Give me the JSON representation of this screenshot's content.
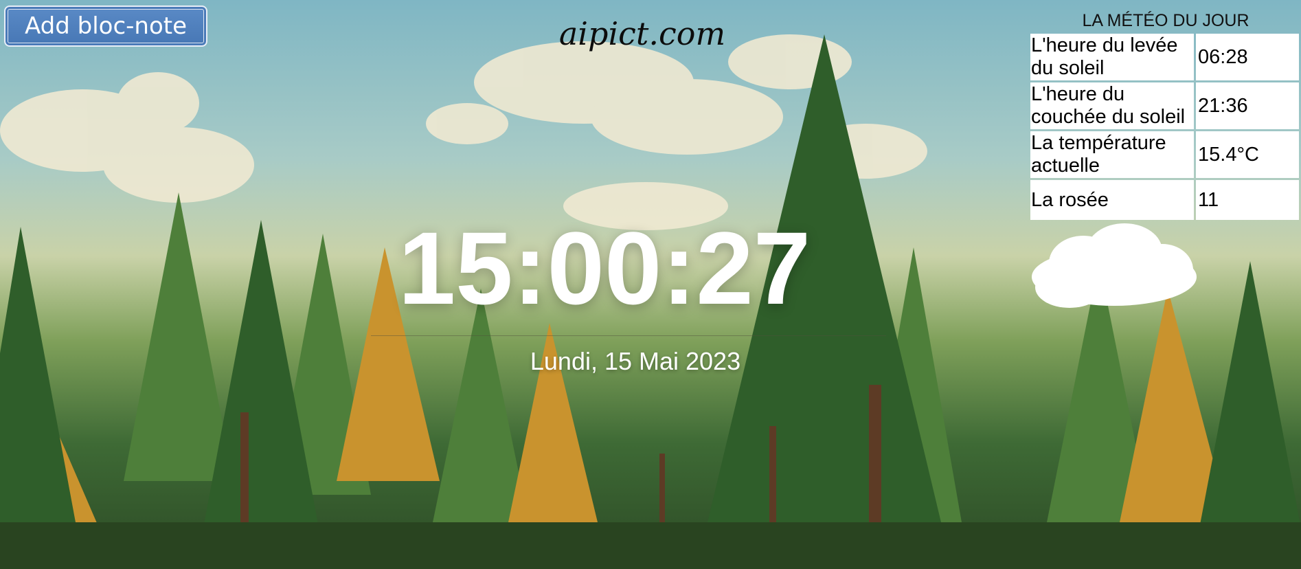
{
  "toolbar": {
    "add_note_label": "Add bloc-note"
  },
  "brand": {
    "name": "aipict.com"
  },
  "clock": {
    "time": "15:00:27",
    "date": "Lundi, 15 Mai 2023"
  },
  "weather": {
    "title": "LA MÉTÉO DU JOUR",
    "rows": [
      {
        "label": "L'heure du levée du soleil",
        "value": "06:28"
      },
      {
        "label": "L'heure du couchée du soleil",
        "value": "21:36"
      },
      {
        "label": "La température actuelle",
        "value": "15.4°C"
      },
      {
        "label": "La rosée",
        "value": "11"
      }
    ],
    "icon": "cloud-icon"
  },
  "background": {
    "icon": "forest-landscape-image"
  }
}
